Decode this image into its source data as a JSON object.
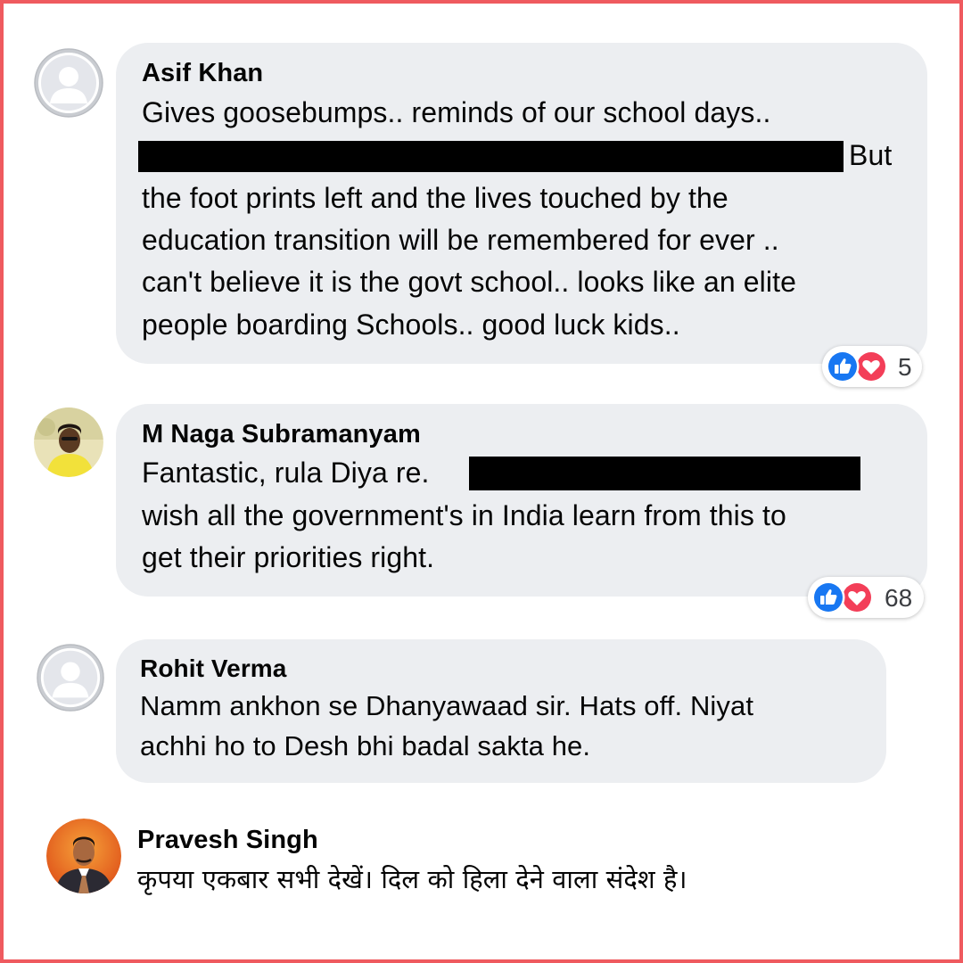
{
  "colors": {
    "bubble": "#eceef1",
    "frame": "#ef5a5f",
    "like_blue": "#1877f2",
    "love_red": "#f33e58"
  },
  "comments": [
    {
      "author": "Asif Khan",
      "avatar": "default-avatar",
      "lines": [
        "Gives goosebumps.. reminds of our school days..",
        "But",
        "the foot prints left and the lives touched by the",
        "education transition will be remembered for ever ..",
        "can't believe it is the govt school.. looks like an elite",
        "people boarding Schools.. good luck kids.."
      ],
      "reactions": {
        "icons": [
          "like-icon",
          "love-icon"
        ],
        "count": "5"
      }
    },
    {
      "author": "M Naga Subramanyam",
      "avatar": "photo-avatar",
      "lines": [
        "Fantastic, rula Diya re.",
        "wish all the government's in India learn from this to",
        "get their priorities right."
      ],
      "reactions": {
        "icons": [
          "like-icon",
          "love-icon"
        ],
        "count": "68"
      }
    },
    {
      "author": "Rohit Verma",
      "avatar": "default-avatar",
      "lines": [
        "Namm ankhon se Dhanyawaad sir. Hats off. Niyat",
        "achhi ho to Desh bhi badal sakta he."
      ]
    },
    {
      "author": "Pravesh Singh",
      "avatar": "photo-avatar",
      "lines": [
        "कृपया एकबार सभी देखें। दिल को हिला देने वाला संदेश है।"
      ]
    }
  ]
}
